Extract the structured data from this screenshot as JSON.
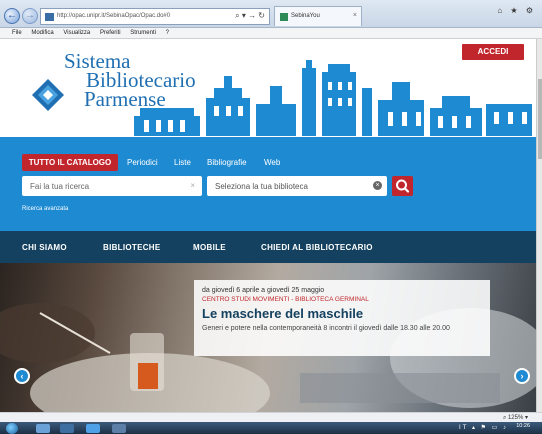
{
  "browser": {
    "url": "http://opac.unipr.it/SebinaOpac/Opac.do#0",
    "address_controls": "⌕ ▾ → ↻",
    "tab_title": "SebinaYou",
    "tab_close": "×",
    "window_controls": "⌂ ★ ⚙",
    "menu": [
      "File",
      "Modifica",
      "Visualizza",
      "Preferiti",
      "Strumenti",
      "?"
    ]
  },
  "header": {
    "login_label": "ACCEDI",
    "logo_lines": [
      "Sistema",
      "Bibliotecario",
      "Parmense"
    ]
  },
  "search": {
    "tabs": [
      "TUTTO IL CATALOGO",
      "Periodici",
      "Liste",
      "Bibliografie",
      "Web"
    ],
    "query_placeholder": "Fai la tua ricerca",
    "library_placeholder": "Seleziona la tua biblioteca",
    "clear_glyph": "×",
    "advanced_label": "Ricerca avanzata"
  },
  "mainnav": {
    "items": [
      "CHI SIAMO",
      "BIBLIOTECHE",
      "MOBILE",
      "CHIEDI AL BIBLIOTECARIO"
    ]
  },
  "hero": {
    "date": "da giovedì 6 aprile a giovedì 25 maggio",
    "organizer": "CENTRO STUDI MOVIMENTI - BIBLIOTECA GERMINAL",
    "title": "Le maschere del maschile",
    "description": "Generi e potere nella contemporaneità 8 incontri il giovedì dalle 18.30 alle 20.00",
    "prev_glyph": "‹",
    "next_glyph": "›"
  },
  "status": {
    "zoom": "⌕ 125% ▾"
  },
  "taskbar": {
    "tray": "IT ▴ ⚑ ▭ ♪",
    "time": "10:26"
  },
  "colors": {
    "brand_red": "#c1262d",
    "brand_blue": "#1e8ad2",
    "nav_dark": "#14415f"
  }
}
